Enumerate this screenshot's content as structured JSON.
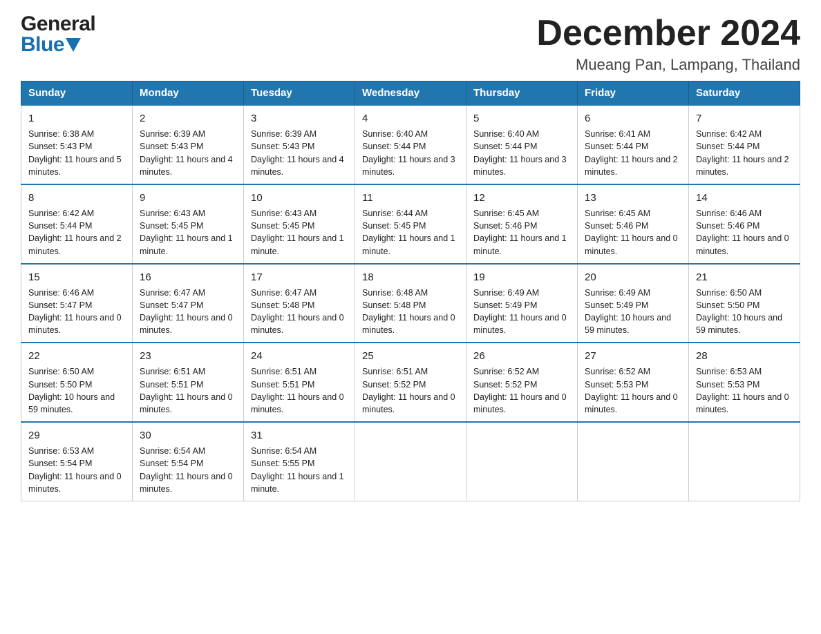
{
  "header": {
    "logo_line1": "General",
    "logo_line2": "Blue",
    "month_title": "December 2024",
    "location": "Mueang Pan, Lampang, Thailand"
  },
  "days_of_week": [
    "Sunday",
    "Monday",
    "Tuesday",
    "Wednesday",
    "Thursday",
    "Friday",
    "Saturday"
  ],
  "weeks": [
    [
      {
        "day": "1",
        "sunrise": "Sunrise: 6:38 AM",
        "sunset": "Sunset: 5:43 PM",
        "daylight": "Daylight: 11 hours and 5 minutes."
      },
      {
        "day": "2",
        "sunrise": "Sunrise: 6:39 AM",
        "sunset": "Sunset: 5:43 PM",
        "daylight": "Daylight: 11 hours and 4 minutes."
      },
      {
        "day": "3",
        "sunrise": "Sunrise: 6:39 AM",
        "sunset": "Sunset: 5:43 PM",
        "daylight": "Daylight: 11 hours and 4 minutes."
      },
      {
        "day": "4",
        "sunrise": "Sunrise: 6:40 AM",
        "sunset": "Sunset: 5:44 PM",
        "daylight": "Daylight: 11 hours and 3 minutes."
      },
      {
        "day": "5",
        "sunrise": "Sunrise: 6:40 AM",
        "sunset": "Sunset: 5:44 PM",
        "daylight": "Daylight: 11 hours and 3 minutes."
      },
      {
        "day": "6",
        "sunrise": "Sunrise: 6:41 AM",
        "sunset": "Sunset: 5:44 PM",
        "daylight": "Daylight: 11 hours and 2 minutes."
      },
      {
        "day": "7",
        "sunrise": "Sunrise: 6:42 AM",
        "sunset": "Sunset: 5:44 PM",
        "daylight": "Daylight: 11 hours and 2 minutes."
      }
    ],
    [
      {
        "day": "8",
        "sunrise": "Sunrise: 6:42 AM",
        "sunset": "Sunset: 5:44 PM",
        "daylight": "Daylight: 11 hours and 2 minutes."
      },
      {
        "day": "9",
        "sunrise": "Sunrise: 6:43 AM",
        "sunset": "Sunset: 5:45 PM",
        "daylight": "Daylight: 11 hours and 1 minute."
      },
      {
        "day": "10",
        "sunrise": "Sunrise: 6:43 AM",
        "sunset": "Sunset: 5:45 PM",
        "daylight": "Daylight: 11 hours and 1 minute."
      },
      {
        "day": "11",
        "sunrise": "Sunrise: 6:44 AM",
        "sunset": "Sunset: 5:45 PM",
        "daylight": "Daylight: 11 hours and 1 minute."
      },
      {
        "day": "12",
        "sunrise": "Sunrise: 6:45 AM",
        "sunset": "Sunset: 5:46 PM",
        "daylight": "Daylight: 11 hours and 1 minute."
      },
      {
        "day": "13",
        "sunrise": "Sunrise: 6:45 AM",
        "sunset": "Sunset: 5:46 PM",
        "daylight": "Daylight: 11 hours and 0 minutes."
      },
      {
        "day": "14",
        "sunrise": "Sunrise: 6:46 AM",
        "sunset": "Sunset: 5:46 PM",
        "daylight": "Daylight: 11 hours and 0 minutes."
      }
    ],
    [
      {
        "day": "15",
        "sunrise": "Sunrise: 6:46 AM",
        "sunset": "Sunset: 5:47 PM",
        "daylight": "Daylight: 11 hours and 0 minutes."
      },
      {
        "day": "16",
        "sunrise": "Sunrise: 6:47 AM",
        "sunset": "Sunset: 5:47 PM",
        "daylight": "Daylight: 11 hours and 0 minutes."
      },
      {
        "day": "17",
        "sunrise": "Sunrise: 6:47 AM",
        "sunset": "Sunset: 5:48 PM",
        "daylight": "Daylight: 11 hours and 0 minutes."
      },
      {
        "day": "18",
        "sunrise": "Sunrise: 6:48 AM",
        "sunset": "Sunset: 5:48 PM",
        "daylight": "Daylight: 11 hours and 0 minutes."
      },
      {
        "day": "19",
        "sunrise": "Sunrise: 6:49 AM",
        "sunset": "Sunset: 5:49 PM",
        "daylight": "Daylight: 11 hours and 0 minutes."
      },
      {
        "day": "20",
        "sunrise": "Sunrise: 6:49 AM",
        "sunset": "Sunset: 5:49 PM",
        "daylight": "Daylight: 10 hours and 59 minutes."
      },
      {
        "day": "21",
        "sunrise": "Sunrise: 6:50 AM",
        "sunset": "Sunset: 5:50 PM",
        "daylight": "Daylight: 10 hours and 59 minutes."
      }
    ],
    [
      {
        "day": "22",
        "sunrise": "Sunrise: 6:50 AM",
        "sunset": "Sunset: 5:50 PM",
        "daylight": "Daylight: 10 hours and 59 minutes."
      },
      {
        "day": "23",
        "sunrise": "Sunrise: 6:51 AM",
        "sunset": "Sunset: 5:51 PM",
        "daylight": "Daylight: 11 hours and 0 minutes."
      },
      {
        "day": "24",
        "sunrise": "Sunrise: 6:51 AM",
        "sunset": "Sunset: 5:51 PM",
        "daylight": "Daylight: 11 hours and 0 minutes."
      },
      {
        "day": "25",
        "sunrise": "Sunrise: 6:51 AM",
        "sunset": "Sunset: 5:52 PM",
        "daylight": "Daylight: 11 hours and 0 minutes."
      },
      {
        "day": "26",
        "sunrise": "Sunrise: 6:52 AM",
        "sunset": "Sunset: 5:52 PM",
        "daylight": "Daylight: 11 hours and 0 minutes."
      },
      {
        "day": "27",
        "sunrise": "Sunrise: 6:52 AM",
        "sunset": "Sunset: 5:53 PM",
        "daylight": "Daylight: 11 hours and 0 minutes."
      },
      {
        "day": "28",
        "sunrise": "Sunrise: 6:53 AM",
        "sunset": "Sunset: 5:53 PM",
        "daylight": "Daylight: 11 hours and 0 minutes."
      }
    ],
    [
      {
        "day": "29",
        "sunrise": "Sunrise: 6:53 AM",
        "sunset": "Sunset: 5:54 PM",
        "daylight": "Daylight: 11 hours and 0 minutes."
      },
      {
        "day": "30",
        "sunrise": "Sunrise: 6:54 AM",
        "sunset": "Sunset: 5:54 PM",
        "daylight": "Daylight: 11 hours and 0 minutes."
      },
      {
        "day": "31",
        "sunrise": "Sunrise: 6:54 AM",
        "sunset": "Sunset: 5:55 PM",
        "daylight": "Daylight: 11 hours and 1 minute."
      },
      null,
      null,
      null,
      null
    ]
  ]
}
